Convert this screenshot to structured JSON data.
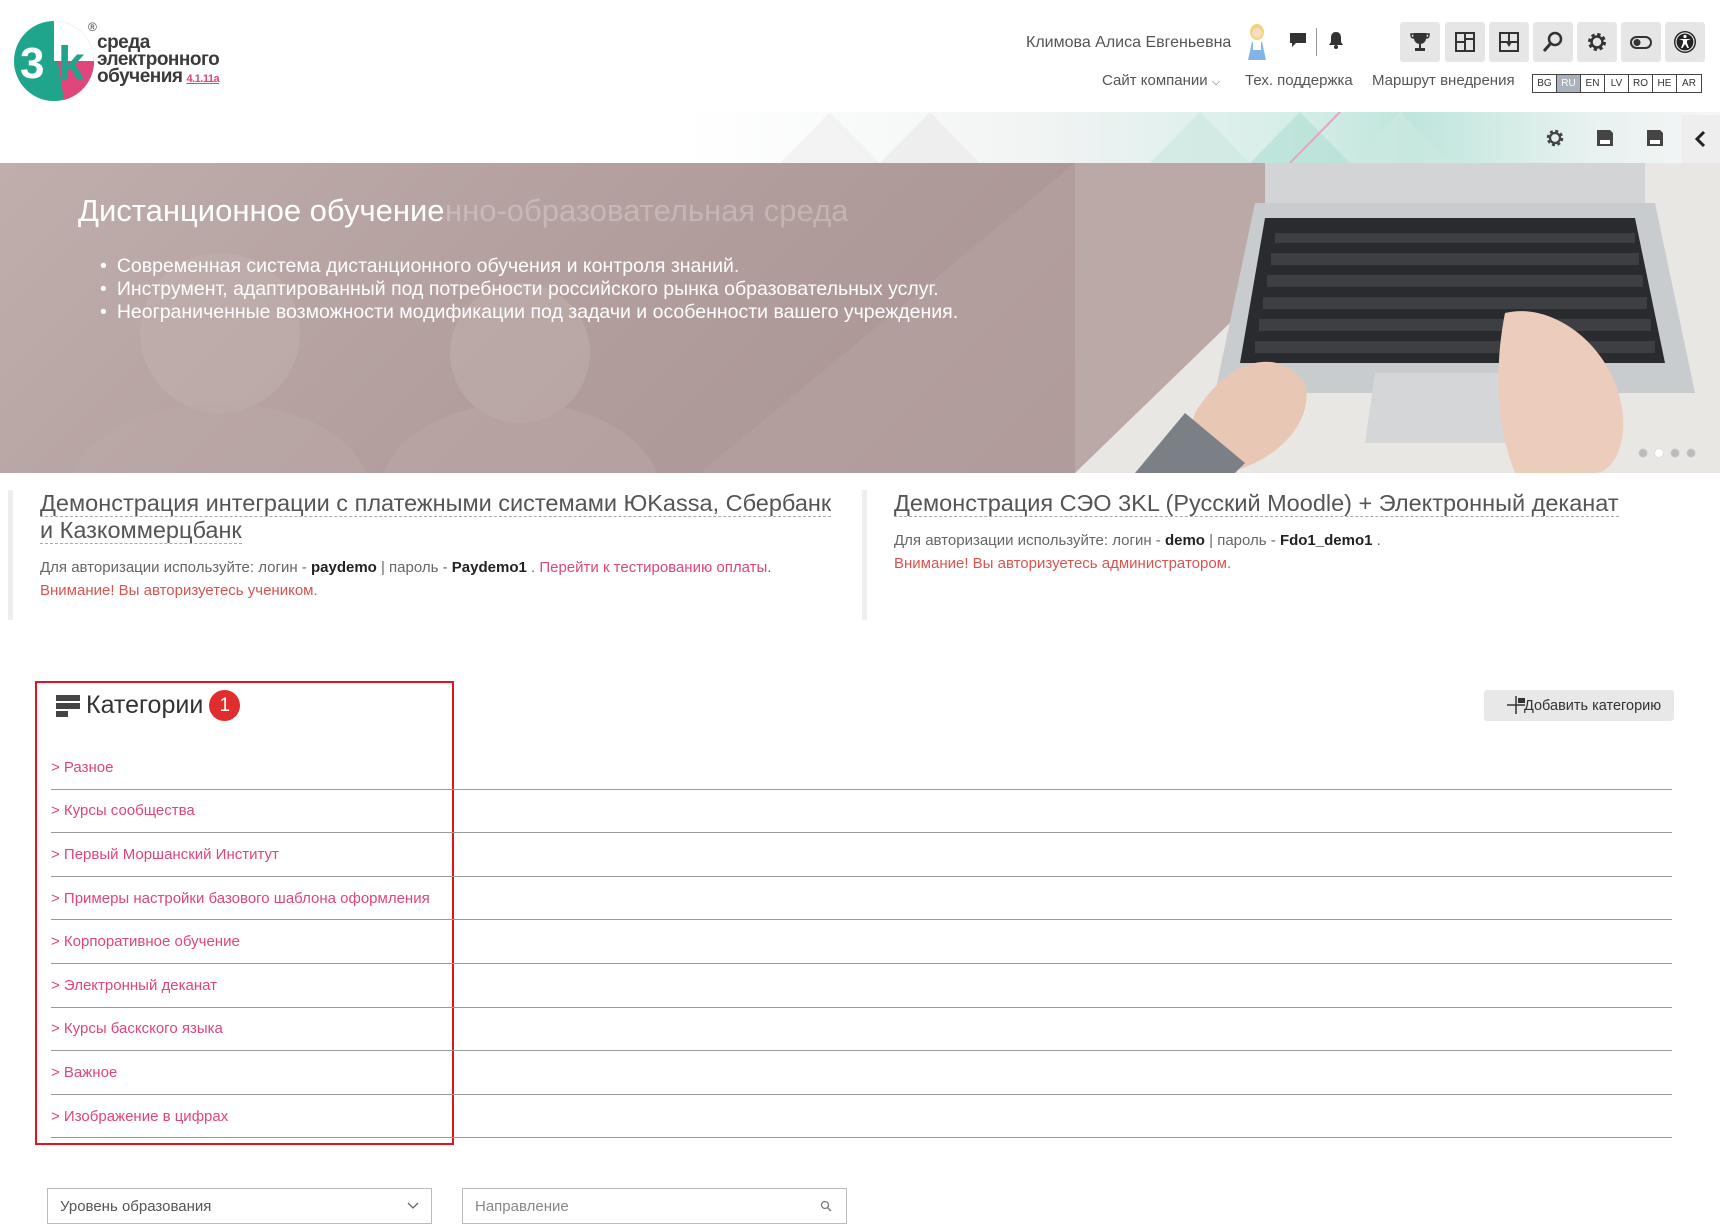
{
  "header": {
    "logo": {
      "line1": "среда",
      "line2": "электронного",
      "line3": "обучения",
      "version": "4.1.11a",
      "reg": "®"
    },
    "user_name": "Климова Алиса Евгеньевна",
    "icons": {
      "chat": "chat-icon",
      "bell": "bell-icon",
      "trophy": "trophy-icon",
      "dashboard": "dashboard-icon",
      "blocks": "blocks-icon",
      "search": "search-icon",
      "settings": "gear-icon",
      "toggle": "toggle-icon",
      "accessibility": "accessibility-icon"
    },
    "nav": {
      "company": "Сайт компании",
      "support": "Тех. поддержка",
      "route": "Маршрут внедрения"
    },
    "languages": [
      "BG",
      "RU",
      "EN",
      "LV",
      "RO",
      "HE",
      "AR"
    ],
    "active_language": "RU"
  },
  "banner": {
    "title": "Дистанционное обучение",
    "title_ghost": "нно-образовательная среда",
    "bullets": [
      "Современная система дистанционного обучения и контроля знаний.",
      "Инструмент, адаптированный под потребности российского рынка образовательных услуг.",
      "Неограниченные возможности модификации под задачи и особенности вашего учреждения."
    ],
    "slides": 4,
    "active_slide": 2
  },
  "demo_left": {
    "title": "Демонстрация интеграции с платежными системами ЮKassa, Сбербанк и Казкоммерцбанк",
    "auth_prefix": "Для авторизации используйте: логин - ",
    "login": "paydemo",
    "sep": " | пароль - ",
    "password": "Paydemo1",
    "tail": " .",
    "link": "Перейти к тестированию оплаты",
    "link_tail": ".",
    "warning": "Внимание! Вы авторизуетесь учеником."
  },
  "demo_right": {
    "title": "Демонстрация СЭО 3KL (Русский Moodle) + Электронный деканат",
    "auth_prefix": "Для авторизации используйте: логин - ",
    "login": "demo",
    "sep": " | пароль - ",
    "password": "Fdo1_demo1",
    "tail": " .",
    "warning": "Внимание! Вы авторизуетесь администратором."
  },
  "categories": {
    "title": "Категории",
    "badge": "1",
    "add_button": "Добавить категорию",
    "items": [
      "> Разное",
      "> Курсы сообщества",
      "> Первый Моршанский Институт",
      "> Примеры настройки базового шаблона оформления",
      "> Корпоративное обучение",
      "> Электронный деканат",
      "> Курсы баскского языка",
      "> Важное",
      "> Изображение в цифрах"
    ]
  },
  "filters": {
    "level_placeholder": "Уровень образования",
    "direction_placeholder": "Направление"
  },
  "colors": {
    "accent": "#e0457b",
    "logo_green": "#1fa58c",
    "logo_pink": "#e0457b",
    "highlight": "#e0141e"
  }
}
